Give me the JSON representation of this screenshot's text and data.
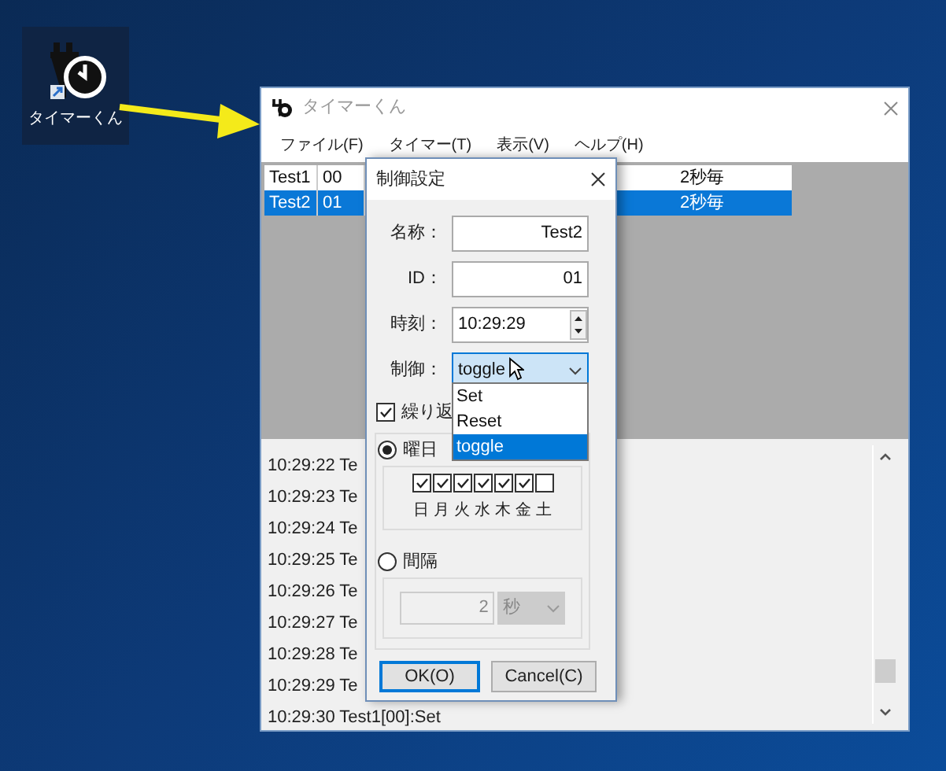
{
  "desktop_icon": {
    "label": "タイマーくん"
  },
  "window": {
    "title": "タイマーくん"
  },
  "menu": [
    "ファイル(F)",
    "タイマー(T)",
    "表示(V)",
    "ヘルプ(H)"
  ],
  "timers": [
    {
      "name": "Test1",
      "id": "00",
      "interval": "2秒毎",
      "selected": false
    },
    {
      "name": "Test2",
      "id": "01",
      "interval": "2秒毎",
      "selected": true
    }
  ],
  "log": [
    "10:29:22 Te",
    "10:29:23 Te",
    "10:29:24 Te",
    "10:29:25 Te",
    "10:29:26 Te",
    "10:29:27 Te",
    "10:29:28 Te",
    "10:29:29 Te",
    "10:29:30 Test1[00]:Set"
  ],
  "dialog": {
    "title": "制御設定",
    "fields": [
      {
        "label": "名称：",
        "value": "Test2",
        "kind": "text"
      },
      {
        "label": "ID：",
        "value": "01",
        "kind": "text"
      },
      {
        "label": "時刻：",
        "value": "10:29:29",
        "kind": "spin"
      }
    ],
    "control": {
      "label": "制御：",
      "value": "toggle",
      "expanded": true,
      "options": [
        {
          "label": "Set",
          "selected": false
        },
        {
          "label": "Reset",
          "selected": false
        },
        {
          "label": "toggle",
          "selected": true
        }
      ]
    },
    "repeat": {
      "label": "繰り返",
      "checked": true
    },
    "weekday": {
      "label": "曜日",
      "selected": true,
      "days": [
        {
          "label": "日",
          "checked": true
        },
        {
          "label": "月",
          "checked": true
        },
        {
          "label": "火",
          "checked": true
        },
        {
          "label": "水",
          "checked": true
        },
        {
          "label": "木",
          "checked": true
        },
        {
          "label": "金",
          "checked": true
        },
        {
          "label": "土",
          "checked": false
        }
      ]
    },
    "interval": {
      "label": "間隔",
      "selected": false,
      "value": "2",
      "unit": "秒"
    },
    "buttons": [
      "OK(O)",
      "Cancel(C)"
    ]
  }
}
